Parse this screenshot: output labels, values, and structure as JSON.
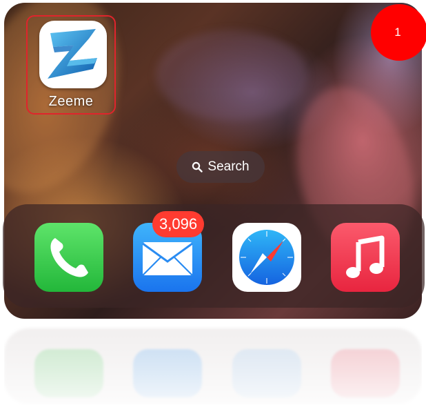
{
  "step_badge": {
    "number": "1",
    "color": "#ff0000"
  },
  "home_screen": {
    "app": {
      "label": "Zeeme",
      "icon": "zeeme-z-icon",
      "highlight_color": "#e0242c"
    },
    "search": {
      "label": "Search",
      "icon": "magnifier-icon"
    }
  },
  "dock": {
    "apps": [
      {
        "name": "Phone",
        "icon": "phone-handset-icon",
        "color": "#2fc443"
      },
      {
        "name": "Mail",
        "icon": "envelope-icon",
        "color": "#1e8cf5",
        "badge": "3,096"
      },
      {
        "name": "Safari",
        "icon": "compass-icon",
        "color": "#1a8cf0"
      },
      {
        "name": "Music",
        "icon": "music-note-icon",
        "color": "#f23a52"
      }
    ]
  }
}
